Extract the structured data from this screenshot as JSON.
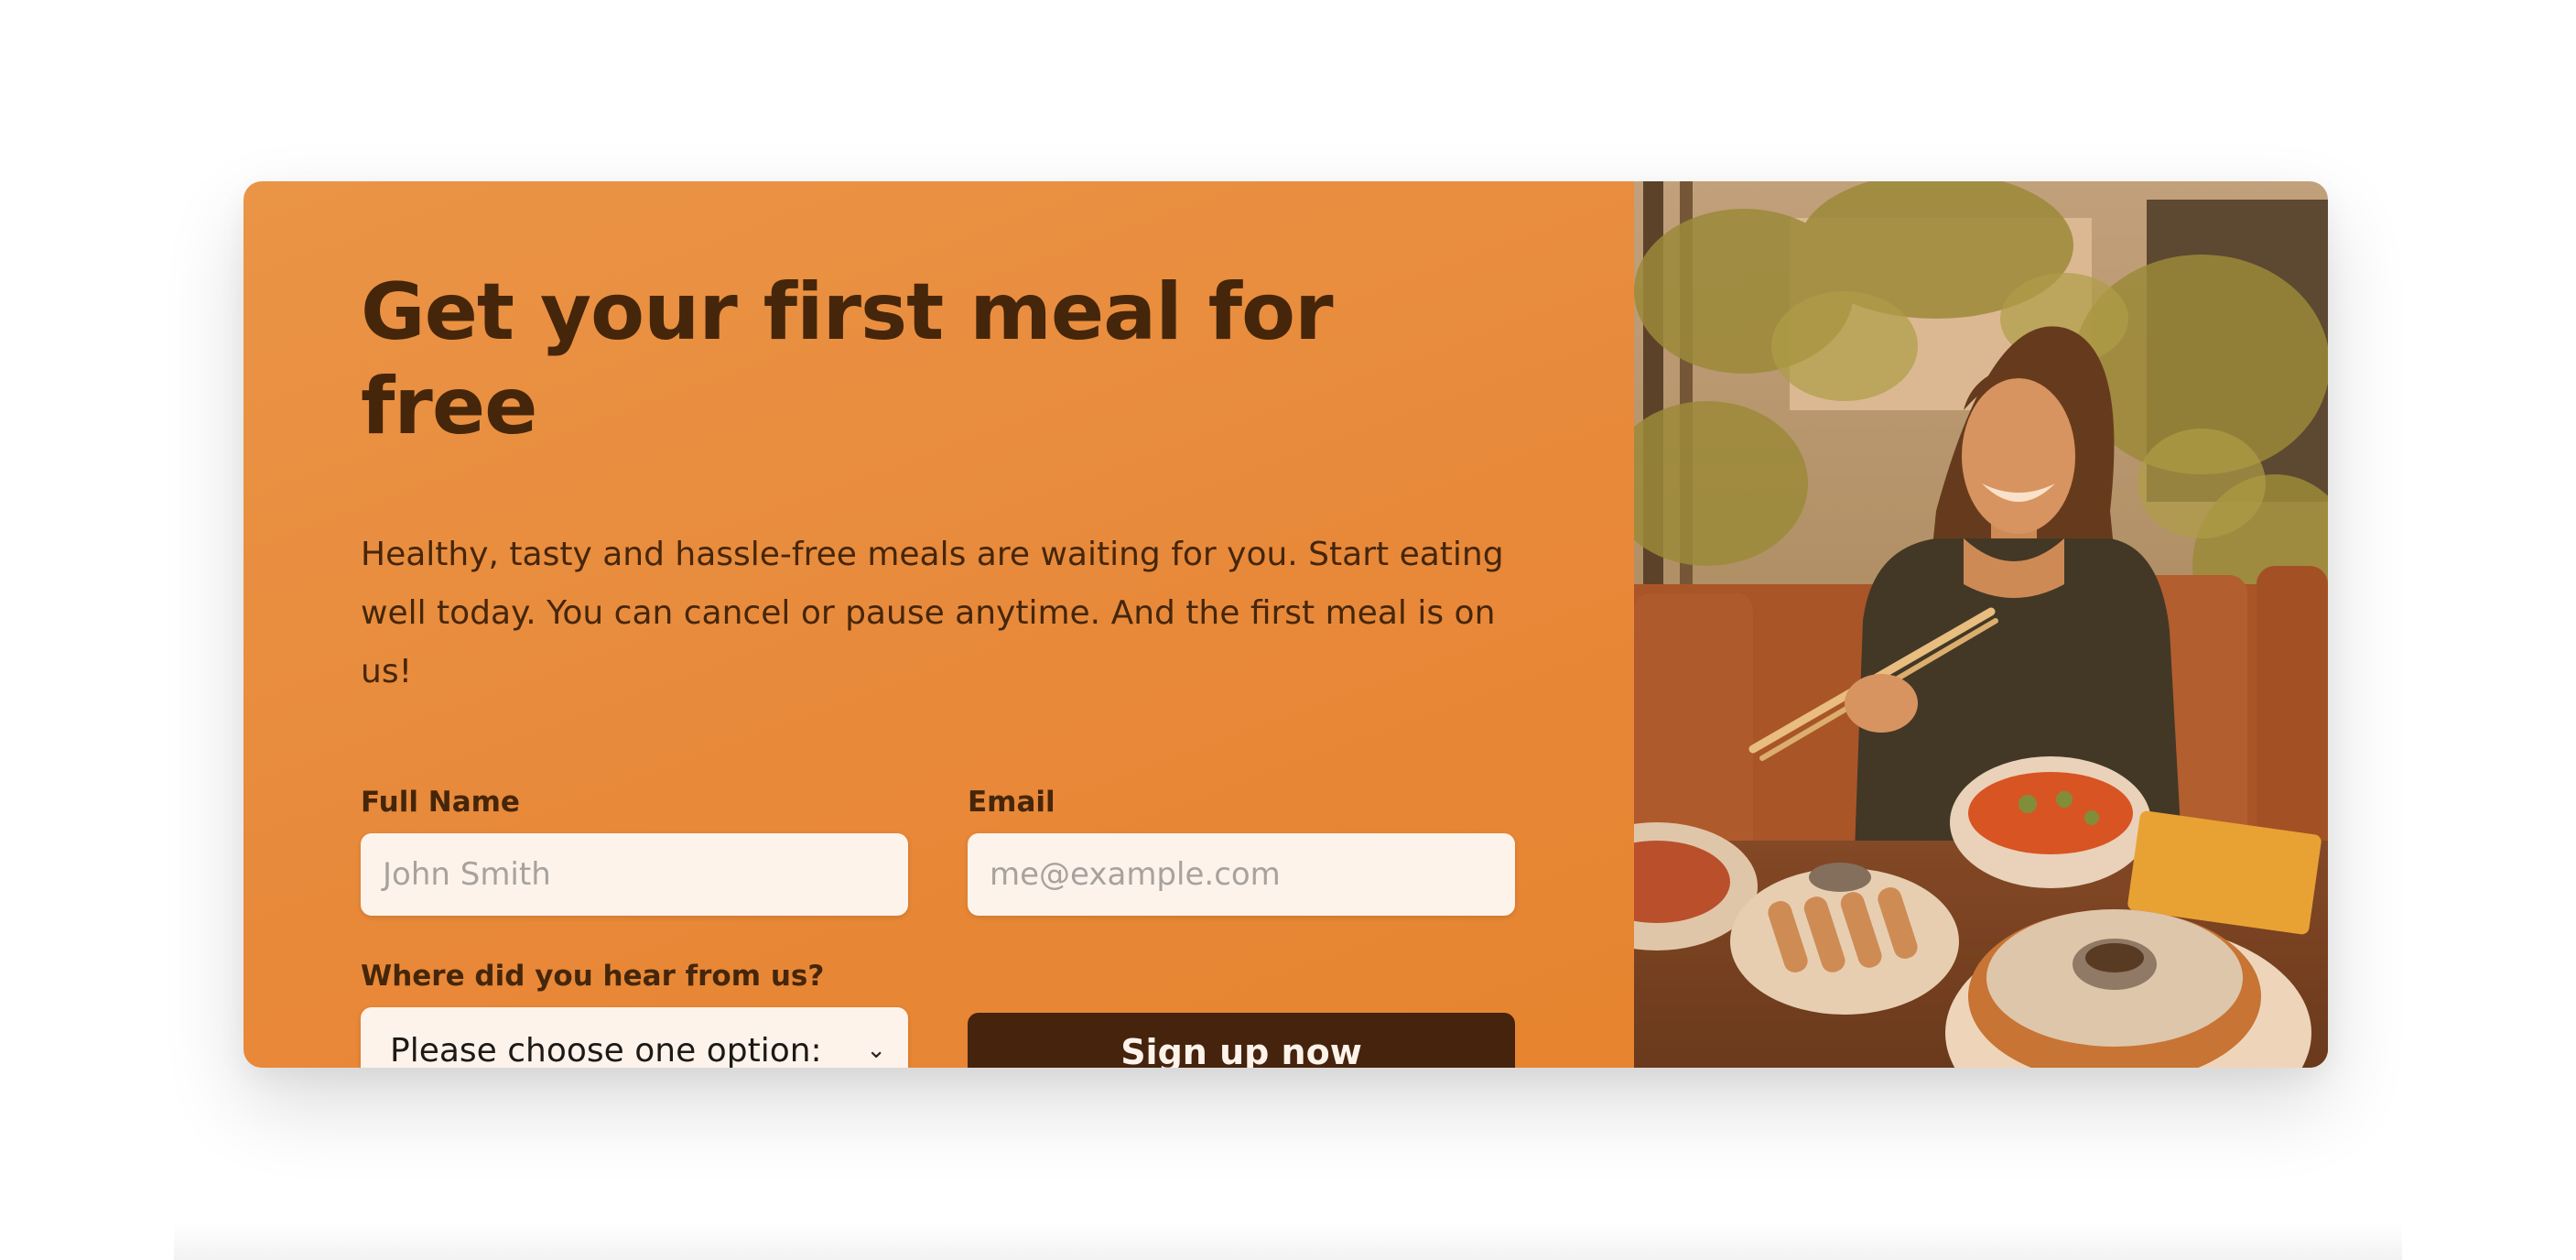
{
  "cta": {
    "title": "Get your first meal for free",
    "description": "Healthy, tasty and hassle-free meals are waiting for you. Start eating well today. You can cancel or pause anytime. And the first meal is on us!",
    "form": {
      "full_name_label": "Full Name",
      "full_name_placeholder": "John Smith",
      "email_label": "Email",
      "email_placeholder": "me@example.com",
      "source_label": "Where did you hear from us?",
      "source_selected": "Please choose one option:",
      "submit_label": "Sign up now"
    }
  },
  "image": {
    "alt": "Woman smiling while eating a meal with chopsticks at a restaurant table"
  },
  "colors": {
    "accent": "#e8893a",
    "dark_brown": "#45260a",
    "input_bg": "#fdf3eb"
  }
}
